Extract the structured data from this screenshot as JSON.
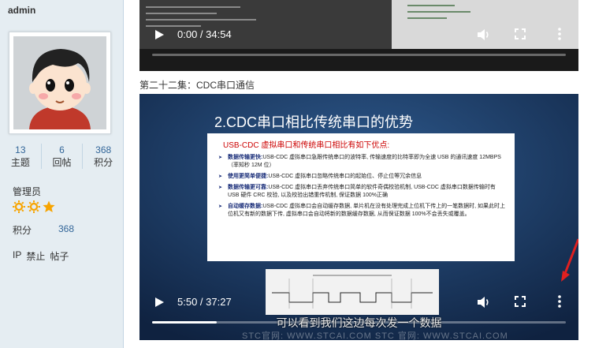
{
  "sidebar": {
    "username": "admin",
    "stats": [
      {
        "value": "13",
        "label": "主题"
      },
      {
        "value": "6",
        "label": "回帖"
      },
      {
        "value": "368",
        "label": "积分"
      }
    ],
    "group": "管理员",
    "points_label": "积分",
    "points_value": "368",
    "actions": [
      "IP",
      "禁止",
      "帖子"
    ]
  },
  "video1": {
    "time": "0:00 / 34:54"
  },
  "caption": "第二十二集：CDC串口通信",
  "video2": {
    "time": "5:50 / 37:27",
    "progress": 0.156,
    "slide": {
      "heading": "2.CDC串口相比传统串口的优势",
      "subheading": "USB-CDC 虚拟串口和传统串口相比有如下优点:",
      "items": [
        {
          "title": "数据传输更快:",
          "text": "USB-CDC 虚拟串口急跟传统串口的波特率, 传输速度的比特率即为全速 USB 的通讯速度 12MBPS（率知秒 12M 位）"
        },
        {
          "title": "使用更简单便捷:",
          "text": "USB-CDC 虚拟串口忽略传统串口的起始位、停止位等冗余信息"
        },
        {
          "title": "数据传输更可靠:",
          "text": "USB-CDC 虚拟串口丢弃传统串口简单的软件奇偶校验机制, USB-CDC 虚拟串口数据传输时有 USB 硬件 CRC 校验, 以及校验出错重传机制, 保证数据 100%正确"
        },
        {
          "title": "自动缓存数据:",
          "text": "USB-CDC 虚拟串口会自动缓存数据, 单片机在没有处理完成上位机下传上的一笔数据时, 如果此时上位机又有新的数据下传, 虚拟串口会自动将新的数据缓存数据, 从而保证数据 100%不会丢失或覆盖。"
        }
      ]
    },
    "subtitle": "可以看到我们这边每次发一个数据",
    "watermark": "STC官网: WWW.STCAI.COM    STC 官网: WWW.STCAI.COM"
  },
  "colors": {
    "sidebar_bg": "#e5edf2",
    "link": "#336699",
    "star": "#f7a400",
    "slide_bg": "#1f3d66"
  }
}
